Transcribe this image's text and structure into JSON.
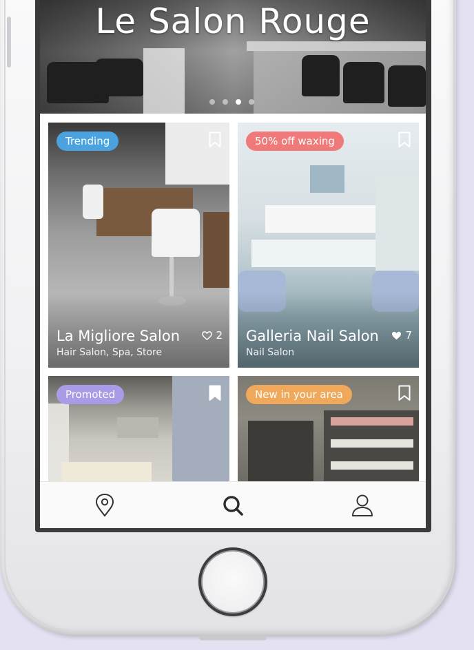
{
  "hero": {
    "title": "Le Salon Rouge",
    "slides": 4,
    "active_slide": 3
  },
  "cards": [
    {
      "badge": "Trending",
      "badge_color": "#4aa3df",
      "title": "La Migliore Salon",
      "subtitle": "Hair Salon, Spa, Store",
      "likes": "2",
      "liked": false,
      "bookmarked": false
    },
    {
      "badge": "50% off waxing",
      "badge_color": "#f07a7a",
      "title": "Galleria Nail Salon",
      "subtitle": "Nail Salon",
      "likes": "7",
      "liked": true,
      "bookmarked": false
    },
    {
      "badge": "Promoted",
      "badge_color": "#a99be6",
      "title": "",
      "subtitle": "",
      "bookmarked": true
    },
    {
      "badge": "New in your area",
      "badge_color": "#f0a95a",
      "title": "",
      "subtitle": "",
      "bookmarked": false
    }
  ],
  "tabs": [
    {
      "icon": "location-pin-icon"
    },
    {
      "icon": "search-icon"
    },
    {
      "icon": "profile-icon"
    }
  ]
}
